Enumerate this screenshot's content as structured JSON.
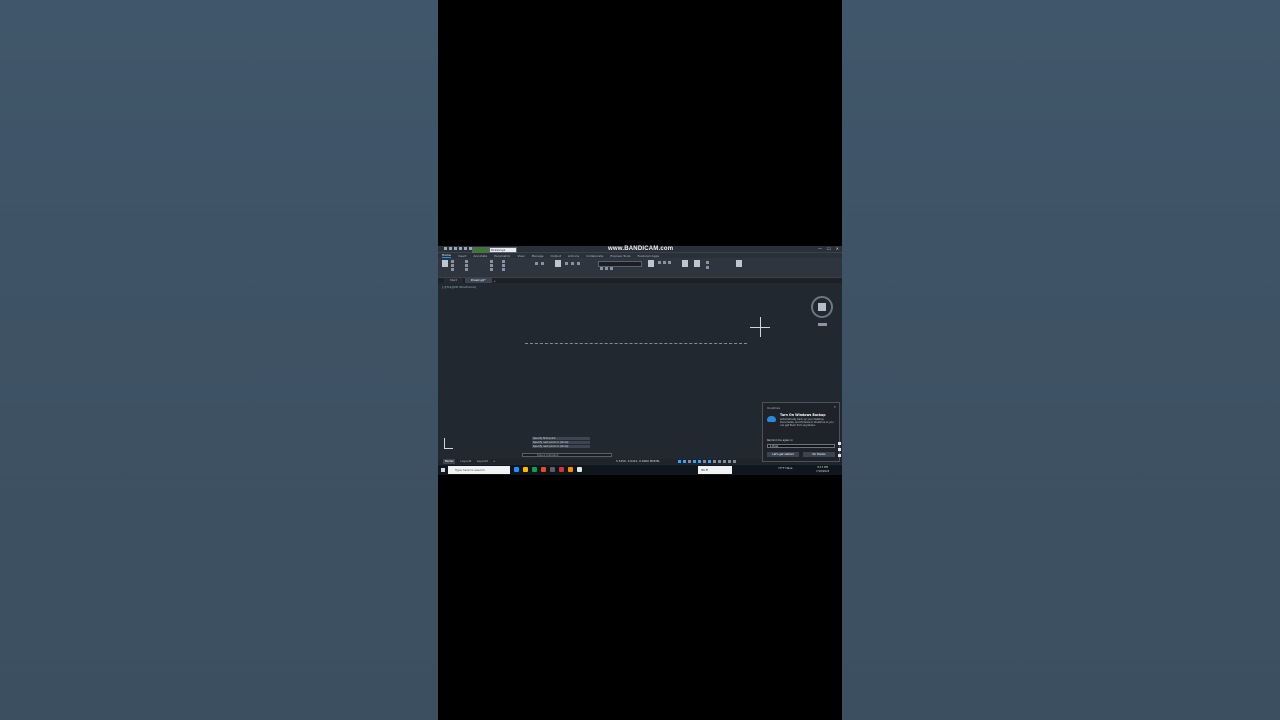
{
  "window": {
    "drawing_dropdown": "Drawing1",
    "workspace_dropdown": "",
    "watermark": "www.BANDICAM.com",
    "controls": [
      "—",
      "☐",
      "✕"
    ]
  },
  "menu": {
    "items": [
      "Home",
      "Insert",
      "Annotate",
      "Parametric",
      "View",
      "Manage",
      "Output",
      "Add-ins",
      "Collaborate",
      "Express Tools",
      "Featured Apps"
    ],
    "active": "Home"
  },
  "tabs": {
    "items": [
      "Start",
      "Drawing1*"
    ],
    "add": "+"
  },
  "viewport": {
    "label": "[-][Top][2D Wireframe]"
  },
  "command": {
    "history": [
      "Specify first point:",
      "Specify next point or [Undo]:",
      "Specify next point or [Undo]:"
    ],
    "placeholder": "Type a command"
  },
  "status": {
    "layout_tabs": [
      "Model",
      "Layout1",
      "Layout2",
      "+"
    ],
    "coords": "5.3250, 3.0421, 0.0000",
    "mode": "MODEL"
  },
  "toast": {
    "app_name": "OneDrive",
    "close": "✕",
    "title": "Turn On Windows Backup",
    "body": "Automatically back up your Desktop, Documents, and Pictures to OneDrive so you can get them from anywhere.",
    "remind_label": "Remind me again in",
    "remind_value": "1 Hour",
    "primary_button": "Let's get started",
    "secondary_button": "No thanks"
  },
  "taskbar": {
    "search_placeholder": "Type here to search",
    "wifi_label": "Wi-Fi",
    "weather": "73°F Haze",
    "time": "8:17 PM",
    "date": "7/18/2023",
    "app_colors": [
      "#1e90ff",
      "#ffb900",
      "#0f9d58",
      "#e34c26",
      "#5e5e5e",
      "#d13438",
      "#ff8c00",
      "#e5e5e5"
    ]
  }
}
